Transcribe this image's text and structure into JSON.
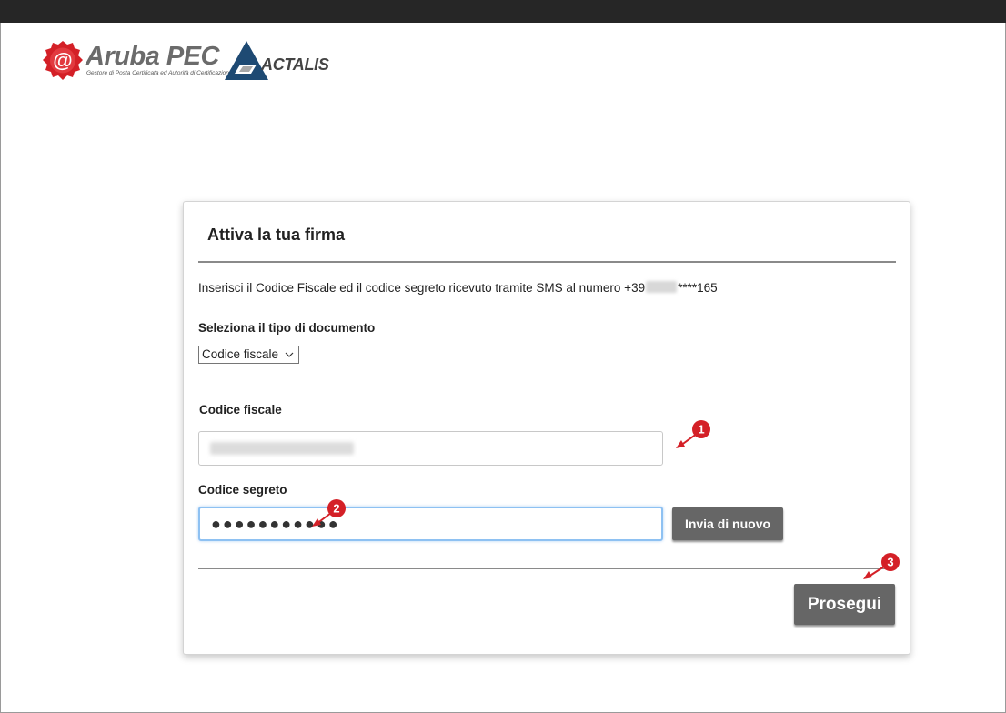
{
  "branding": {
    "aruba_name": "Aruba PEC",
    "aruba_tagline": "Gestore di Posta Certificata ed Autorità di Certificazione",
    "actalis_name": "ACTALIS",
    "aruba_color": "#d42027",
    "actalis_color": "#1e4a73"
  },
  "card": {
    "title": "Attiva la tua firma",
    "instructions_prefix": "Inserisci il Codice Fiscale ed il codice segreto ricevuto tramite SMS al numero +39",
    "instructions_suffix": "****165"
  },
  "document_type": {
    "label": "Seleziona il tipo di documento",
    "selected": "Codice fiscale"
  },
  "codice_fiscale": {
    "label": "Codice fiscale"
  },
  "codice_segreto": {
    "label": "Codice segreto",
    "value_masked": "●●●●●●●●●●●"
  },
  "buttons": {
    "resend": "Invia di nuovo",
    "continue": "Prosegui"
  },
  "annotations": {
    "step1": "1",
    "step2": "2",
    "step3": "3",
    "color": "#d42027"
  }
}
